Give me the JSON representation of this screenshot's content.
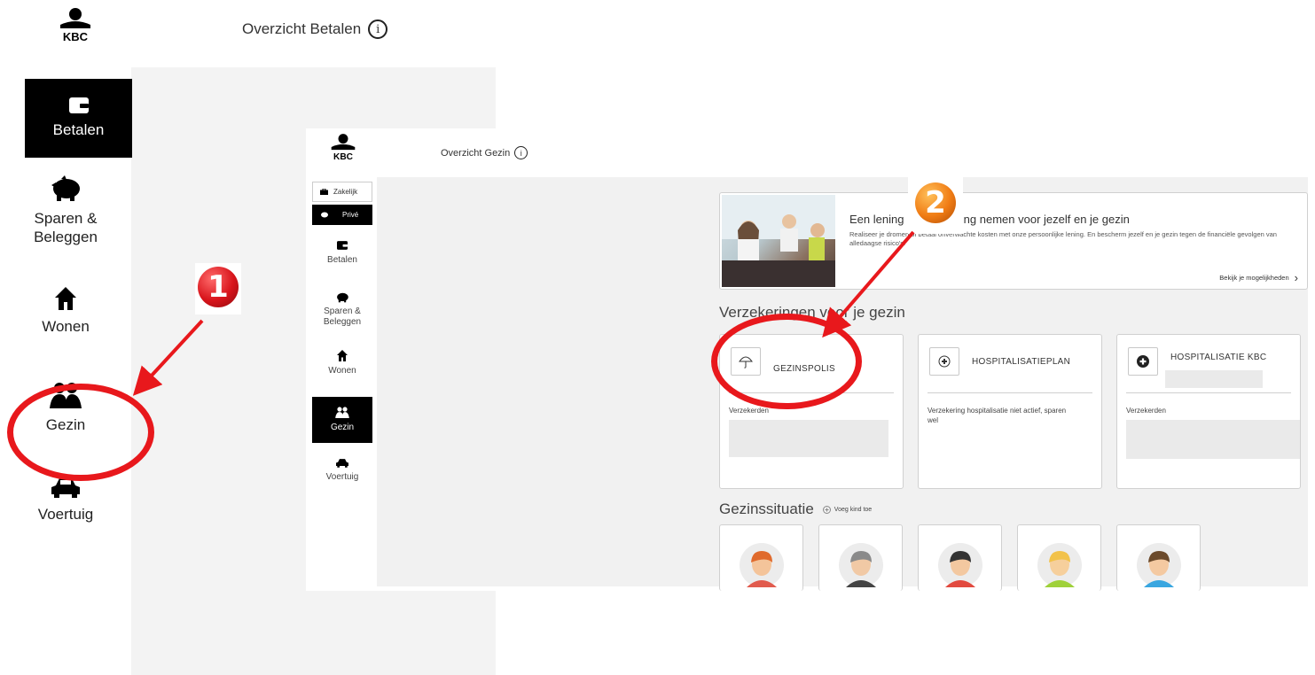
{
  "outer": {
    "brand": "KBC",
    "page_title": "Overzicht Betalen",
    "info_glyph": "i",
    "nav": [
      {
        "label": "Betalen",
        "icon": "wallet-icon",
        "active": true
      },
      {
        "label": "Sparen & Beleggen",
        "icon": "piggy-bank-icon",
        "active": false
      },
      {
        "label": "Wonen",
        "icon": "house-icon",
        "active": false
      },
      {
        "label": "Gezin",
        "icon": "family-icon",
        "active": false
      },
      {
        "label": "Voertuig",
        "icon": "car-icon",
        "active": false
      }
    ]
  },
  "inset": {
    "brand": "KBC",
    "page_title": "Overzicht Gezin",
    "info_glyph": "i",
    "segments": [
      {
        "label": "Zakelijk",
        "active": false
      },
      {
        "label": "Privé",
        "active": true
      }
    ],
    "nav": [
      {
        "label": "Betalen",
        "active": false
      },
      {
        "label": "Sparen & Beleggen",
        "active": false
      },
      {
        "label": "Wonen",
        "active": false
      },
      {
        "label": "Gezin",
        "active": true
      },
      {
        "label": "Voertuig",
        "active": false
      }
    ],
    "promo": {
      "title_left": "Een lening",
      "title_right": "ring nemen voor jezelf en je gezin",
      "text": "Realiseer je dromen of betaal onverwachte kosten met onze persoonlijke lening. En bescherm jezelf en je gezin tegen de financiële gevolgen van alledaagse risico's.",
      "link": "Bekijk je mogelijkheden",
      "link_arrow": "›"
    },
    "insurance_section_title": "Verzekeringen voor je gezin",
    "insurance_cards": [
      {
        "name": "GEZINSPOLIS",
        "label": "Verzekerden",
        "icon": "umbrella-icon"
      },
      {
        "name": "HOSPITALISATIEPLAN",
        "label": "Verzekering hospitalisatie niet actief, sparen wel",
        "icon": "hospital-icon"
      },
      {
        "name": "HOSPITALISATIE KBC",
        "label": "Verzekerden",
        "icon": "medical-cross-icon"
      }
    ],
    "family_section_title": "Gezinssituatie",
    "add_child": "Voeg kind toe",
    "family_members": [
      {
        "icon": "avatar-woman-red-hair-icon",
        "skin": "#f4c49a",
        "hair": "#e06a2c",
        "shirt": "#e15b4d"
      },
      {
        "icon": "avatar-bearded-man-icon",
        "skin": "#f1c9a5",
        "hair": "#8a8a8a",
        "shirt": "#444444"
      },
      {
        "icon": "avatar-man-glasses-icon",
        "skin": "#f3c8a0",
        "hair": "#333333",
        "shirt": "#e24a3f"
      },
      {
        "icon": "avatar-blond-child-icon",
        "skin": "#f6cf9c",
        "hair": "#f2c24a",
        "shirt": "#9fd13a"
      },
      {
        "icon": "avatar-boy-icon",
        "skin": "#f4c9a1",
        "hair": "#6b4a2b",
        "shirt": "#39a6e0"
      }
    ]
  },
  "annotations": [
    {
      "number": "1",
      "color": "#d8141b"
    },
    {
      "number": "2",
      "color": "#f07c14"
    }
  ],
  "colors": {
    "accent_red": "#e8181c",
    "nav_active": "#000000",
    "panel_gray": "#f3f3f3"
  }
}
